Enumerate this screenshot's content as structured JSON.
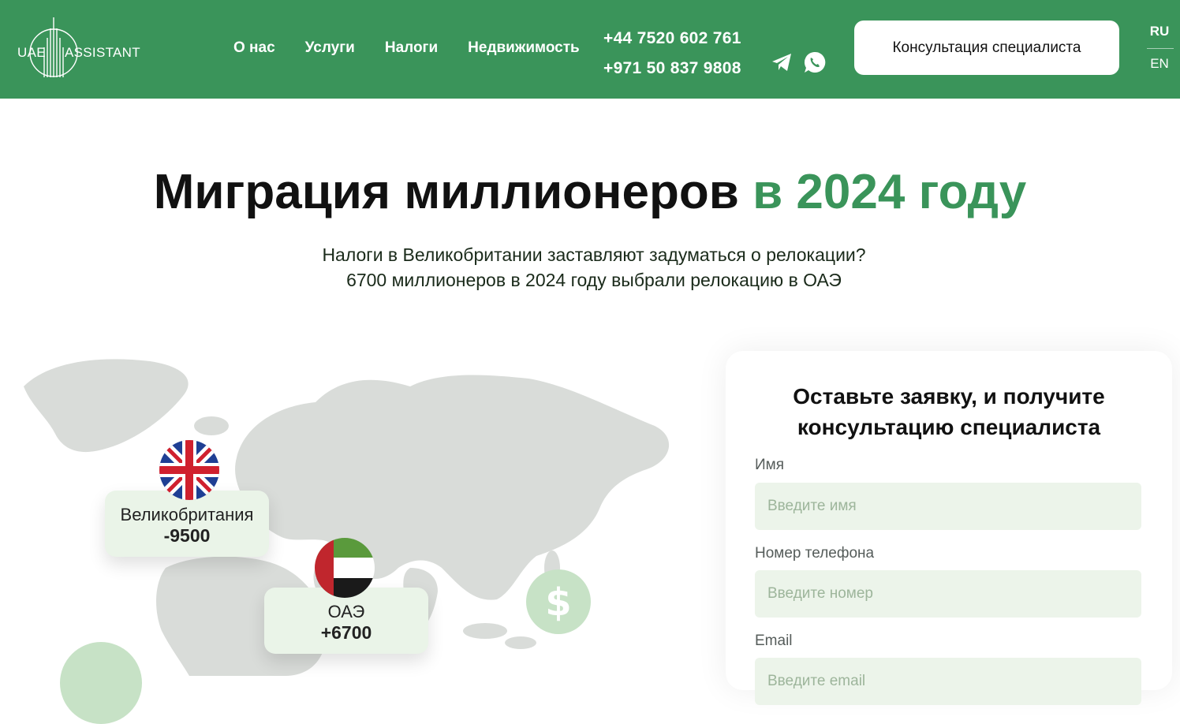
{
  "header": {
    "logo": {
      "left_text": "UAE",
      "right_text": "ASSISTANT"
    },
    "nav": [
      "О нас",
      "Услуги",
      "Налоги",
      "Недвижимость"
    ],
    "phones": [
      "+44 7520 602 761",
      "+971 50 837 9808"
    ],
    "social_icons": [
      "telegram-icon",
      "whatsapp-icon"
    ],
    "cta_label": "Консультация специалиста",
    "languages": [
      "RU",
      "EN"
    ],
    "active_language": "RU"
  },
  "hero": {
    "title_main": "Миграция миллионеров",
    "title_accent": "в 2024 году",
    "subtitle_line1": "Налоги в Великобритании заставляют задуматься о релокации?",
    "subtitle_line2": "6700 миллионеров в 2024 году выбрали релокацию в ОАЭ"
  },
  "map": {
    "uk": {
      "name": "Великобритания",
      "value": "-9500",
      "flag_icon": "uk-flag-icon"
    },
    "uae": {
      "name": "ОАЭ",
      "value": "+6700",
      "flag_icon": "uae-flag-icon"
    },
    "decorations": [
      "dollar-coin-icon",
      "dollar-coin-icon"
    ]
  },
  "form": {
    "title_line1": "Оставьте заявку, и получите",
    "title_line2": "консультацию специалиста",
    "name_label": "Имя",
    "name_placeholder": "Введите имя",
    "phone_label": "Номер телефона",
    "phone_placeholder": "Введите номер",
    "email_label": "Email",
    "email_placeholder": "Введите email"
  },
  "colors": {
    "brand_green": "#3a945a",
    "field_bg": "#ecf4ea",
    "card_bg": "#eaf4e8",
    "map_land": "#d9dcd9"
  }
}
